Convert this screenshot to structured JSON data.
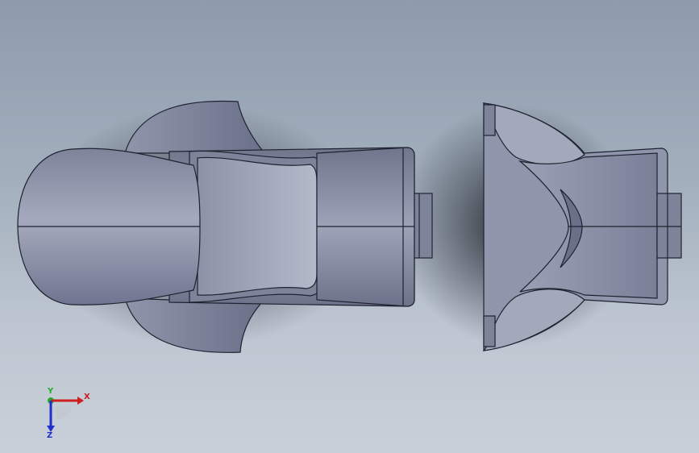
{
  "viewport": {
    "model": "cad-part-assembly",
    "colors": {
      "background_top": "#8d9bab",
      "background_bottom": "#c9d0d9",
      "part_light": "#9aa0b4",
      "part_mid": "#7b8198",
      "part_dark": "#5f657c",
      "edge": "#1e2230",
      "shadow": "#2b313c"
    }
  },
  "triad": {
    "x_label": "X",
    "y_label": "Y",
    "z_label": "Z",
    "x_color": "#cc1f1f",
    "y_color": "#1fae2e",
    "z_color": "#1f2fcc"
  }
}
